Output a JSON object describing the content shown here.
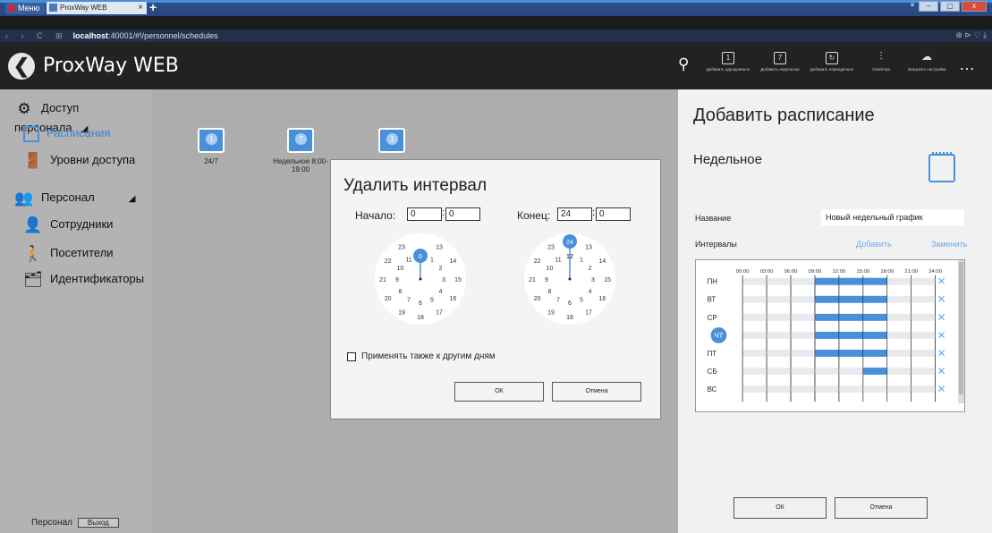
{
  "browser": {
    "menu_label": "Меню",
    "tab_title": "ProxWay WEB",
    "tab_close": "×",
    "new_tab": "+",
    "url_host": "localhost",
    "url_rest": ":40001/#!/personnel/schedules",
    "nav_buttons": "‹ › C ⊞",
    "right_tools": "⊛ ⊳ ♡ ⤓"
  },
  "header": {
    "logo_glyph": "❮",
    "app_title": "ProxWay WEB",
    "buttons": [
      {
        "label": "Добавить однодневное",
        "icon": "add-daily-schedule-icon"
      },
      {
        "label": "Добавить недельное",
        "icon": "add-weekly-schedule-icon"
      },
      {
        "label": "Добавить периодичное",
        "icon": "add-periodic-schedule-icon"
      },
      {
        "label": "Свойства",
        "icon": "properties-icon"
      },
      {
        "label": "Загрузить настройки",
        "icon": "cloud-upload-icon"
      }
    ],
    "more": "…"
  },
  "sidebar": {
    "sections": [
      {
        "label": "Доступ персонала",
        "items": [
          "Расписания",
          "Уровни доступа"
        ]
      },
      {
        "label": "Персонал",
        "items": [
          "Сотрудники",
          "Посетители",
          "Идентификаторы"
        ]
      }
    ],
    "footer_text": "Персонал",
    "logout": "Выход"
  },
  "schedules": [
    {
      "badge": "1",
      "label": "24/7"
    },
    {
      "badge": "7",
      "label": "Недельное 8:00-19:00"
    },
    {
      "badge": "1",
      "label": ""
    }
  ],
  "dialog": {
    "title": "Удалить интервал",
    "start_label": "Начало:",
    "start_h": "0",
    "start_m": "0",
    "end_label": "Конец:",
    "end_h": "24",
    "end_m": "0",
    "start_selected": "0",
    "end_selected": "24",
    "clock_outer": [
      "13",
      "14",
      "15",
      "16",
      "17",
      "18",
      "19",
      "20",
      "21",
      "22",
      "23"
    ],
    "clock_inner": [
      "12",
      "1",
      "2",
      "3",
      "4",
      "5",
      "6",
      "7",
      "8",
      "9",
      "10",
      "11"
    ],
    "apply_label": "Применять также к другим дням",
    "ok": "ОК",
    "cancel": "Отмена"
  },
  "right_panel": {
    "title": "Добавить расписание",
    "type": "Недельное",
    "name_label": "Название",
    "name_value": "Новый недельный график",
    "intervals_label": "Интервалы",
    "add": "Добавить",
    "replace": "Заменить",
    "hours": [
      "00:00",
      "03:00",
      "06:00",
      "09:00",
      "12:00",
      "15:00",
      "18:00",
      "21:00",
      "24:00"
    ],
    "days": [
      {
        "label": "ПН",
        "start": 9,
        "end": 18
      },
      {
        "label": "ВТ",
        "start": 9,
        "end": 18
      },
      {
        "label": "СР",
        "start": 9,
        "end": 18
      },
      {
        "label": "ЧТ",
        "start": 9,
        "end": 18,
        "selected": true
      },
      {
        "label": "ПТ",
        "start": 9,
        "end": 18
      },
      {
        "label": "СБ",
        "start": 15,
        "end": 18
      },
      {
        "label": "ВС"
      }
    ],
    "ok": "ОК",
    "cancel": "Отмена"
  },
  "colors": {
    "accent": "#4a90d9",
    "bar": "#4a90d9",
    "light_accent": "#a7cdf2"
  }
}
